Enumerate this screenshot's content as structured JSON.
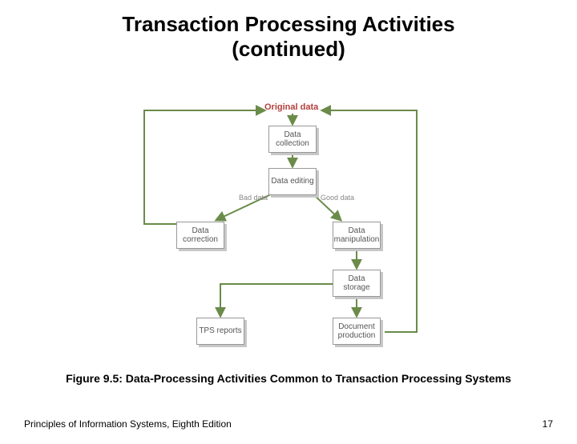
{
  "title_line1": "Transaction Processing Activities",
  "title_line2": "(continued)",
  "diagram": {
    "original": "Original data",
    "collection": "Data collection",
    "editing": "Data editing",
    "bad": "Bad data",
    "good": "Good data",
    "correction": "Data correction",
    "manipulation": "Data manipulation",
    "storage": "Data storage",
    "tps": "TPS reports",
    "document": "Document production"
  },
  "caption": "Figure 9.5: Data-Processing Activities Common to Transaction Processing Systems",
  "footer_left": "Principles of Information Systems, Eighth Edition",
  "footer_right": "17",
  "colors": {
    "accent_red": "#b13f3a",
    "arrow": "#6a8b49"
  }
}
